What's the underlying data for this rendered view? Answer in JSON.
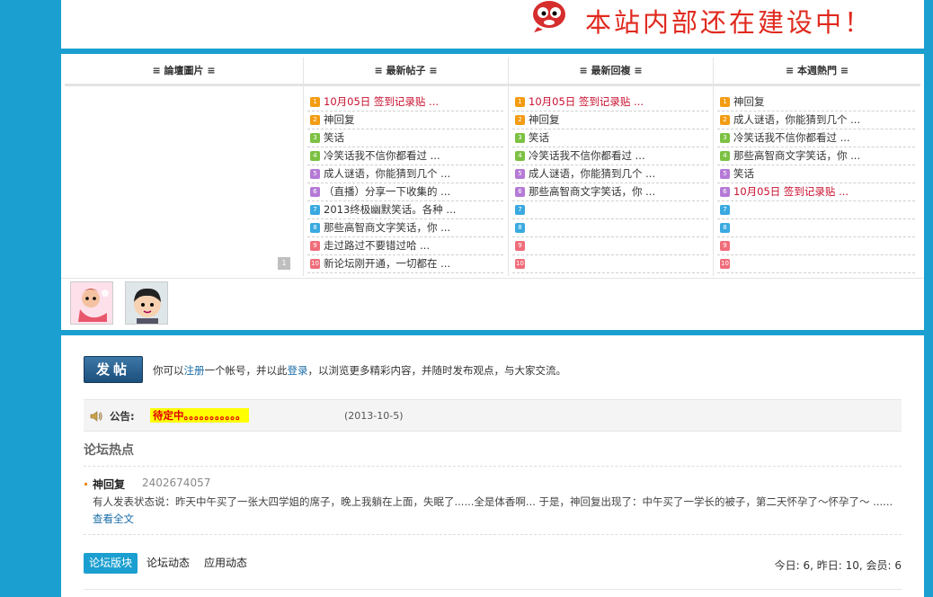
{
  "banner": {
    "text": "本站内部还在建设中！"
  },
  "columns": [
    {
      "title": "≡ 論壇圖片 ≡"
    },
    {
      "title": "≡ 最新帖子 ≡"
    },
    {
      "title": "≡ 最新回複 ≡"
    },
    {
      "title": "≡ 本週熱門 ≡"
    }
  ],
  "latest_posts": [
    {
      "n": "1",
      "text": "10月05日 签到记录贴 ...",
      "highlight": true
    },
    {
      "n": "2",
      "text": "神回复"
    },
    {
      "n": "3",
      "text": "笑话"
    },
    {
      "n": "4",
      "text": "冷笑话我不信你都看过 ..."
    },
    {
      "n": "5",
      "text": "成人谜语，你能猜到几个 ..."
    },
    {
      "n": "6",
      "text": "（直播）分享一下收集的 ..."
    },
    {
      "n": "7",
      "text": "2013终极幽默笑话。各种 ..."
    },
    {
      "n": "8",
      "text": "那些高智商文字笑话，你 ..."
    },
    {
      "n": "9",
      "text": "走过路过不要错过哈 ..."
    },
    {
      "n": "10",
      "text": "新论坛刚开通，一切都在 ..."
    }
  ],
  "latest_replies": [
    {
      "n": "1",
      "text": "10月05日 签到记录贴 ...",
      "highlight": true
    },
    {
      "n": "2",
      "text": "神回复"
    },
    {
      "n": "3",
      "text": "笑话"
    },
    {
      "n": "4",
      "text": "冷笑话我不信你都看过 ..."
    },
    {
      "n": "5",
      "text": "成人谜语，你能猜到几个 ..."
    },
    {
      "n": "6",
      "text": "那些高智商文字笑话，你 ..."
    },
    {
      "n": "7",
      "text": ""
    },
    {
      "n": "8",
      "text": ""
    },
    {
      "n": "9",
      "text": ""
    },
    {
      "n": "10",
      "text": ""
    }
  ],
  "weekly_hot": [
    {
      "n": "1",
      "text": "神回复"
    },
    {
      "n": "2",
      "text": "成人谜语，你能猜到几个 ..."
    },
    {
      "n": "3",
      "text": "冷笑话我不信你都看过 ..."
    },
    {
      "n": "4",
      "text": "那些高智商文字笑话，你 ..."
    },
    {
      "n": "5",
      "text": "笑话"
    },
    {
      "n": "6",
      "text": "10月05日 签到记录贴 ...",
      "highlight": true
    },
    {
      "n": "7",
      "text": ""
    },
    {
      "n": "8",
      "text": ""
    },
    {
      "n": "9",
      "text": ""
    },
    {
      "n": "10",
      "text": ""
    }
  ],
  "pic_indicator": "1",
  "rank_colors": [
    "#f39c12",
    "#f39c12",
    "#7cc142",
    "#7cc142",
    "#b57ad6",
    "#b57ad6",
    "#3aa9e0",
    "#3aa9e0",
    "#ef6d7a",
    "#ef6d7a"
  ],
  "post": {
    "button": "发帖",
    "text_1": "你可以",
    "register": "注册",
    "text_2": "一个帐号，并以此",
    "login": "登录",
    "text_3": "，以浏览更多精彩内容，并随时发布观点，与大家交流。"
  },
  "notice": {
    "label": "公告:",
    "value": "待定中。。。。。。。。。。。",
    "date": "(2013-10-5)"
  },
  "hot": {
    "title": "论坛热点",
    "name": "神回复",
    "id": "2402674057",
    "body": "有人发表状态说：昨天中午买了一张大四学姐的席子，晚上我躺在上面，失眠了......全是体香啊... 于是，神回复出现了：中午买了一学长的被子，第二天怀孕了～怀孕了～ ......",
    "more": "查看全文"
  },
  "tabs": [
    "论坛版块",
    "论坛动态",
    "应用动态"
  ],
  "stats": "今日: 6, 昨日: 10, 会员: 6"
}
